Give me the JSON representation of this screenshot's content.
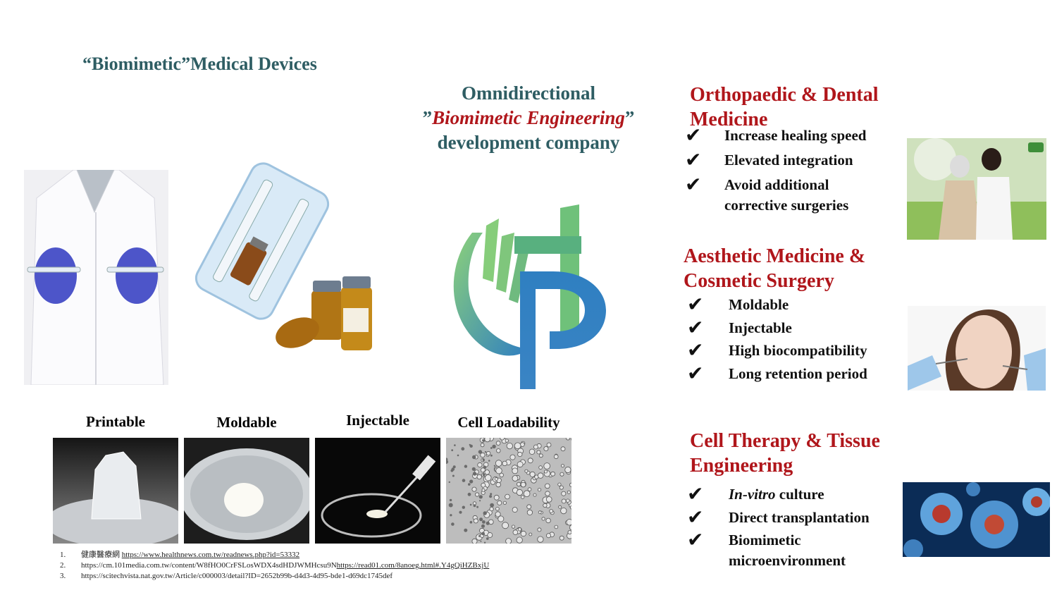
{
  "header": {
    "title": "“Biomimetic”Medical Devices"
  },
  "center": {
    "line1": "Omnidirectional",
    "quote_open": "”",
    "emphasis": "Biomimetic Engineering",
    "quote_close": "”",
    "line3": "development company"
  },
  "sections": [
    {
      "title": "Orthopaedic & Dental Medicine",
      "items": [
        "Increase healing speed",
        "Elevated integration",
        "Avoid additional corrective surgeries"
      ]
    },
    {
      "title": "Aesthetic Medicine & Cosmetic Surgery",
      "items": [
        "Moldable",
        "Injectable",
        "High biocompatibility",
        "Long retention period"
      ]
    },
    {
      "title": "Cell Therapy & Tissue Engineering",
      "items": [
        {
          "italic": "In-vitro",
          "rest": " culture"
        },
        "Direct transplantation",
        "Biomimetic microenvironment"
      ]
    }
  ],
  "check_glyph": "✔",
  "properties": [
    "Printable",
    "Moldable",
    "Injectable",
    "Cell Loadability"
  ],
  "references": [
    {
      "num": "1.",
      "prefix": "健康醫療網 ",
      "link": "https://www.healthnews.com.tw/readnews.php?id=53332"
    },
    {
      "num": "2.",
      "prefix": "https://cm.101media.com.tw/content/W8fHO0CrFSLosWDX4sdHDJWMHcsu9N",
      "link": "https://read01.com/8anoeg.html#.Y4gQiHZBxjU"
    },
    {
      "num": "3.",
      "prefix": "https://scitechvista.nat.gov.tw/Article/c000003/detail?ID=2652b99b-d4d3-4d95-bde1-d69dc1745def",
      "link": ""
    }
  ],
  "colors": {
    "teal": "#2e5d63",
    "red": "#b0161b",
    "logo_green": "#7cc27a",
    "logo_blue": "#2f7fc1"
  },
  "icons": [
    "lab-coat-hands-photo",
    "syringe-kit-photo",
    "logo-hand-icon",
    "elderly-care-photo",
    "cosmetic-injection-photo",
    "cells-photo"
  ]
}
